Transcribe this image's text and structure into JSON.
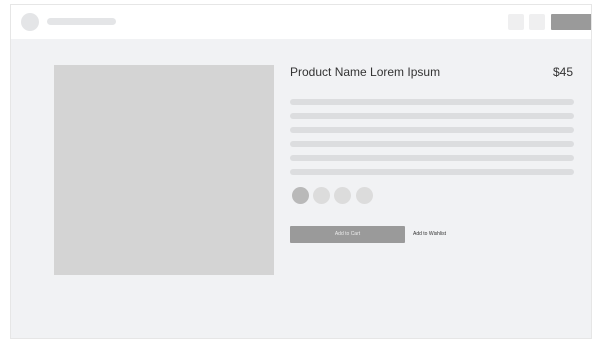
{
  "product": {
    "name": "Product Name Lorem Ipsum",
    "price": "$45"
  },
  "actions": {
    "add_to_cart_label": "Add to Cart",
    "add_to_wishlist_label": "Add to Wishlist"
  },
  "color_options": {
    "count": 4,
    "selected_index": 0
  },
  "colors": {
    "page_background": "#f1f2f4",
    "topbar_background": "#ffffff",
    "image_placeholder": "#d4d4d4",
    "primary_button": "#9a9a9a",
    "skeleton": "#dcdddf"
  }
}
